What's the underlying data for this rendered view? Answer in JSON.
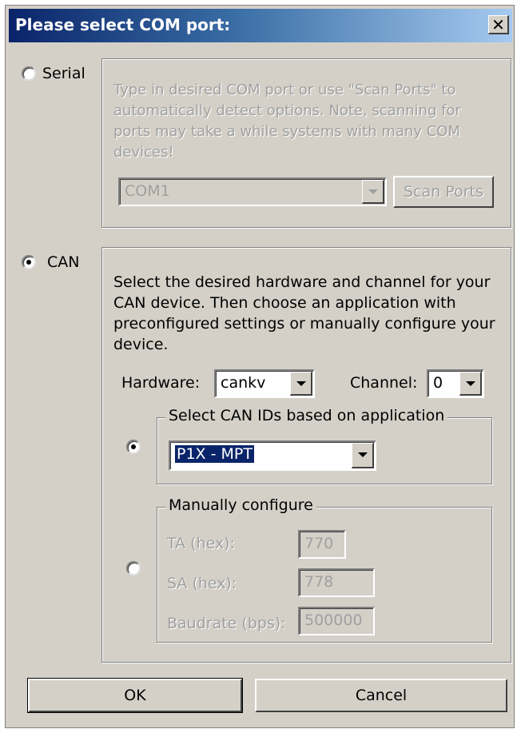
{
  "dialog": {
    "title": "Please select COM port:",
    "close_glyph": "✕"
  },
  "serial": {
    "label": "Serial",
    "selected": false,
    "description": "Type in desired COM port or use \"Scan Ports\" to automatically detect options. Note, scanning for ports may take a while systems with many COM devices!",
    "port_value": "COM1",
    "scan_label": "Scan Ports"
  },
  "can": {
    "label": "CAN",
    "selected": true,
    "description": "Select the desired hardware and channel for your CAN device. Then choose an application with preconfigured settings or manually configure your device.",
    "hardware_label": "Hardware:",
    "hardware_value": "cankv",
    "channel_label": "Channel:",
    "channel_value": "0",
    "app_group_label": "Select CAN IDs based on application",
    "app_value": "P1X - MPT",
    "manual_group_label": "Manually configure",
    "ta_label": "TA (hex):",
    "ta_value": "770",
    "sa_label": "SA (hex):",
    "sa_value": "778",
    "baud_label": "Baudrate (bps):",
    "baud_value": "500000"
  },
  "buttons": {
    "ok": "OK",
    "cancel": "Cancel"
  }
}
